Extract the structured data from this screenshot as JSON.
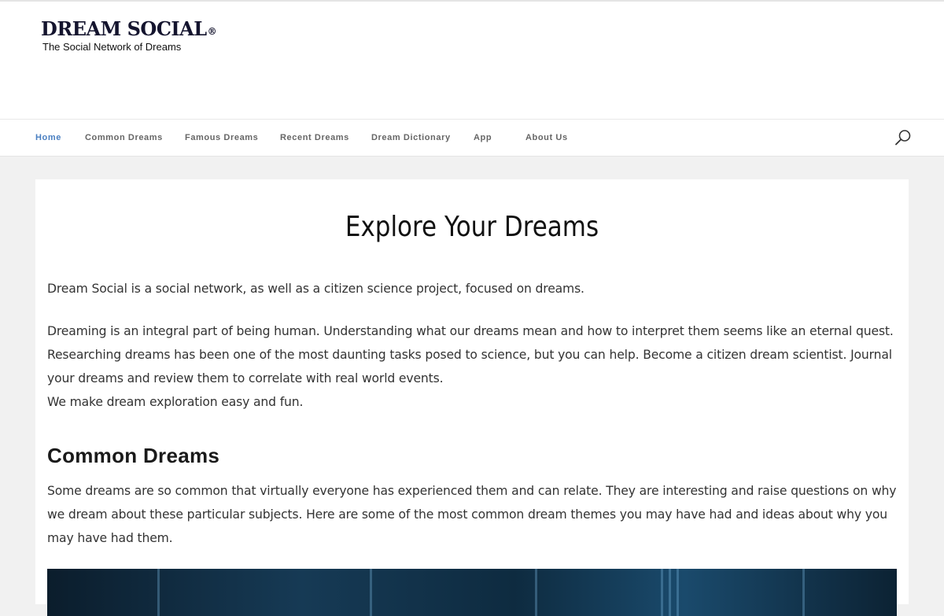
{
  "logo": {
    "title": "DREAM SOCIAL",
    "registered": "®",
    "tagline": "The Social Network of Dreams"
  },
  "nav": {
    "items": [
      {
        "label": "Home",
        "active": true
      },
      {
        "label": "Common Dreams"
      },
      {
        "label": "Famous Dreams"
      },
      {
        "label": "Recent Dreams"
      },
      {
        "label": "Dream Dictionary"
      },
      {
        "label": "App"
      },
      {
        "label": "About Us"
      }
    ],
    "search_icon": "search-icon"
  },
  "main": {
    "title": "Explore Your Dreams",
    "intro": "Dream Social is a social network, as well as a citizen science project, focused on dreams.",
    "paragraph_2": "Dreaming is an integral part of being human. Understanding what our dreams mean and how to interpret them seems like an eternal quest. Researching dreams has been one of the most daunting tasks posed to science, but you can help. Become a citizen dream scientist. Journal your dreams and review them to correlate with real world events.",
    "paragraph_3": "We make dream exploration easy and fun.",
    "common_dreams": {
      "heading": "Common Dreams",
      "text": "Some dreams are so common that virtually everyone has experienced them and can relate. They are interesting and raise questions on why we dream about these particular subjects. Here are some of the most common dream themes you may have had and ideas about why you may have had them."
    }
  },
  "colors": {
    "accent": "#4a7fc1",
    "nav_text": "#666666",
    "background": "#f1f1f1"
  }
}
